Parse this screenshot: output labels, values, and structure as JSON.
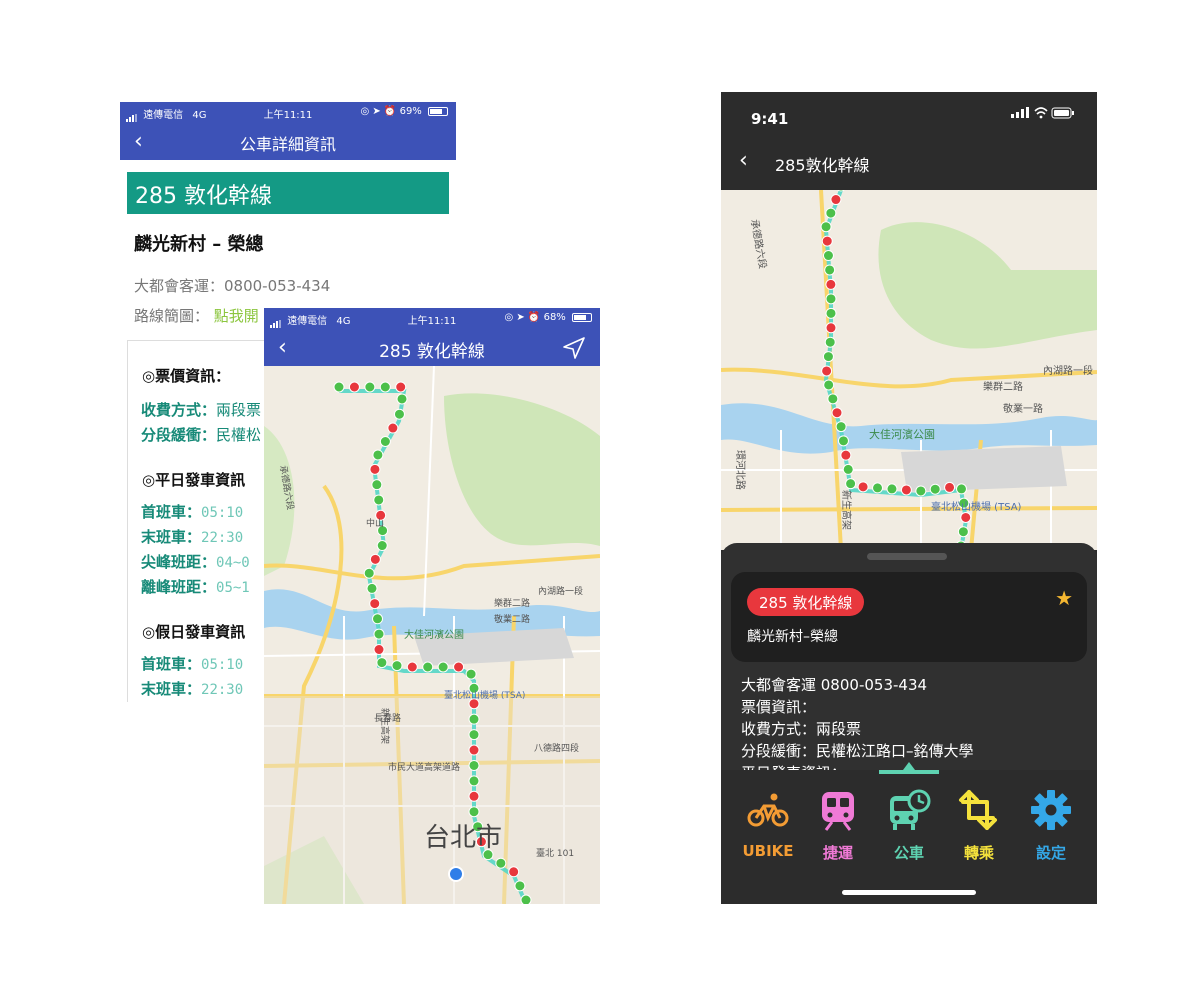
{
  "screen1": {
    "status": {
      "carrier": "遠傳電信",
      "network": "4G",
      "time": "上午11:11",
      "battery": "69%"
    },
    "nav_title": "公車詳細資訊",
    "route_title": "285 敦化幹線",
    "stops": "麟光新村 – 榮總",
    "company": "大都會客運：0800-053-434",
    "map_label": "路線簡圖：",
    "map_link": "點我開",
    "fare_section": "◎票價資訊：",
    "fare_rows": [
      {
        "k": "收費方式：",
        "v": "兩段票"
      },
      {
        "k": "分段緩衝：",
        "v": "民權松"
      }
    ],
    "weekday_section": "◎平日發車資訊",
    "weekday_rows": [
      {
        "k": "首班車：",
        "v": "05:10"
      },
      {
        "k": "末班車：",
        "v": "22:30"
      },
      {
        "k": "尖峰班距：",
        "v": "04~0"
      },
      {
        "k": "離峰班距：",
        "v": "05~1"
      }
    ],
    "holiday_section": "◎假日發車資訊",
    "holiday_rows": [
      {
        "k": "首班車：",
        "v": "05:10"
      },
      {
        "k": "末班車：",
        "v": "22:30"
      }
    ]
  },
  "screen2": {
    "status": {
      "carrier": "遠傳電信",
      "network": "4G",
      "time": "上午11:11",
      "battery": "68%"
    },
    "nav_title": "285 敦化幹線",
    "map_labels": {
      "park": "大佳河濱公園",
      "airport": "臺北松山機場 (TSA)",
      "city": "台北市",
      "neihu": "內湖路一段",
      "lequn": "樂群二路",
      "jinger": "敬業二路",
      "shilin": "承德路六段",
      "zhongzheng": "中山",
      "bade": "八德路四段",
      "civic": "市民大道高架道路",
      "taipei101": "臺北 101",
      "changchun": "長春路",
      "xinsheng": "新生高架"
    }
  },
  "screen3": {
    "time": "9:41",
    "nav_title": "285敦化幹線",
    "map_labels": {
      "park": "大佳河濱公園",
      "airport": "臺北松山機場 (TSA)",
      "neihu": "內湖路一段",
      "lequn": "樂群二路",
      "jinger": "敬業一路",
      "shilin": "承德路六段",
      "huanhe": "環河北路",
      "xinsheng": "新生高架"
    },
    "pill": "285 敦化幹線",
    "card_stops": "麟光新村–榮總",
    "info_lines": [
      "大都會客運 0800-053-434",
      "票價資訊：",
      "收費方式：兩段票",
      "分段緩衝：民權松江路口–銘傳大學",
      "平日發車資訊："
    ],
    "tabs": [
      {
        "label": "UBIKE",
        "color": "#f39c34",
        "icon": "bike-icon"
      },
      {
        "label": "捷運",
        "color": "#f07ad6",
        "icon": "metro-icon"
      },
      {
        "label": "公車",
        "color": "#5ed2b1",
        "icon": "bus-icon"
      },
      {
        "label": "轉乘",
        "color": "#f5e23c",
        "icon": "transfer-icon"
      },
      {
        "label": "設定",
        "color": "#34a8e8",
        "icon": "gear-icon"
      }
    ]
  }
}
